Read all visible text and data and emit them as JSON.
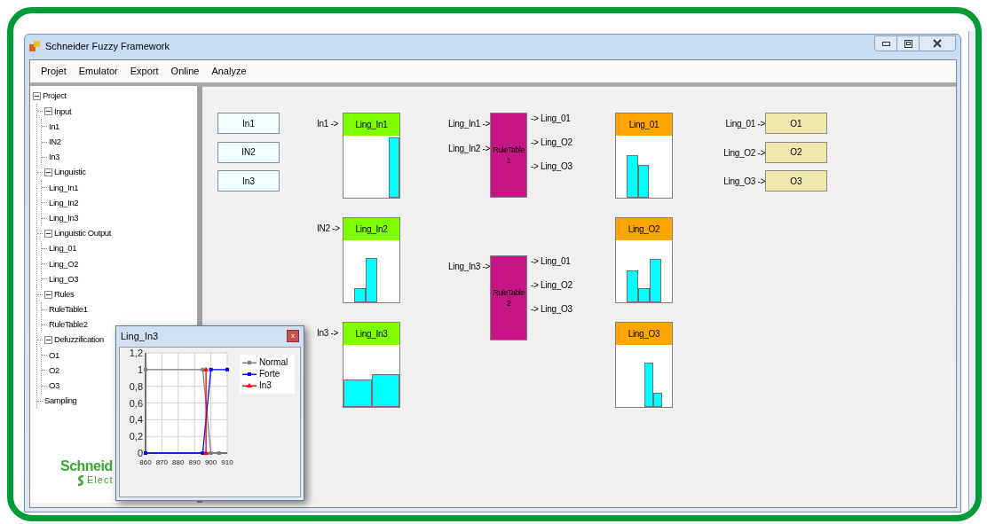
{
  "window": {
    "title": "Schneider Fuzzy Framework"
  },
  "menu": [
    "Projet",
    "Emulator",
    "Export",
    "Online",
    "Analyze"
  ],
  "tree": [
    {
      "label": "Project",
      "expanded": true,
      "children": [
        {
          "label": "Input",
          "expanded": true,
          "children": [
            {
              "label": "In1"
            },
            {
              "label": "IN2"
            },
            {
              "label": "In3"
            }
          ]
        },
        {
          "label": "Linguistic",
          "expanded": true,
          "children": [
            {
              "label": "Ling_In1"
            },
            {
              "label": "Ling_In2"
            },
            {
              "label": "Ling_In3"
            }
          ]
        },
        {
          "label": "Linguistic Output",
          "expanded": true,
          "children": [
            {
              "label": "Ling_01"
            },
            {
              "label": "Ling_O2"
            },
            {
              "label": "Ling_O3"
            }
          ]
        },
        {
          "label": "Rules",
          "expanded": true,
          "children": [
            {
              "label": "RuleTable1"
            },
            {
              "label": "RuleTable2"
            }
          ]
        },
        {
          "label": "Defuzzification",
          "expanded": true,
          "children": [
            {
              "label": "O1"
            },
            {
              "label": "O2"
            },
            {
              "label": "O3"
            }
          ]
        },
        {
          "label": "Sampling"
        }
      ]
    }
  ],
  "logo": {
    "name": "Schneid",
    "sub": "Elect"
  },
  "inputs": [
    "In1",
    "IN2",
    "In3"
  ],
  "linguistic": [
    {
      "input": "In1 ->",
      "title": "Ling_In1"
    },
    {
      "input": "IN2 ->",
      "title": "Ling_In2"
    },
    {
      "input": "In3 ->",
      "title": "Ling_In3"
    }
  ],
  "rule_tables": [
    {
      "inputs": [
        "Ling_In1 ->",
        "Ling_In2 ->"
      ],
      "label": "RuleTable\n1",
      "outputs": [
        "-> Ling_01",
        "-> Ling_O2",
        "-> Ling_O3"
      ]
    },
    {
      "inputs": [
        "Ling_In3 ->"
      ],
      "label": "RuleTable\n2",
      "outputs": [
        "-> Ling_01",
        "-> Ling_O2",
        "-> Ling_O3"
      ]
    }
  ],
  "linguistic_outputs": [
    {
      "title": "Ling_01"
    },
    {
      "title": "Ling_O2"
    },
    {
      "title": "Ling_O3"
    }
  ],
  "outputs": [
    {
      "input": "Ling_01 ->",
      "label": "O1"
    },
    {
      "input": "Ling_O2 ->",
      "label": "O2"
    },
    {
      "input": "Ling_O3 ->",
      "label": "O3"
    }
  ],
  "popup": {
    "title": "Ling_In3",
    "close": "x",
    "chart_data": {
      "type": "line",
      "grid": true,
      "legend": true,
      "xlim": [
        860,
        910
      ],
      "ylim": [
        0,
        1.2
      ],
      "xticks": [
        860,
        870,
        880,
        890,
        900,
        910
      ],
      "yticks": [
        {
          "value": 0,
          "label": "0"
        },
        {
          "value": 0.2,
          "label": "0,2"
        },
        {
          "value": 0.4,
          "label": "0,4"
        },
        {
          "value": 0.6,
          "label": "0,6"
        },
        {
          "value": 0.8,
          "label": "0,8"
        },
        {
          "value": 1,
          "label": "1"
        },
        {
          "value": 1.2,
          "label": "1,2"
        }
      ],
      "series": [
        {
          "name": "Normal",
          "color": "#808080",
          "marker": "square",
          "x": [
            860,
            895,
            900,
            905
          ],
          "values": [
            1,
            1,
            0,
            0
          ]
        },
        {
          "name": "Forte",
          "color": "#0000ff",
          "marker": "square",
          "x": [
            860,
            895,
            900,
            910
          ],
          "values": [
            0,
            0,
            1,
            1
          ]
        },
        {
          "name": "In3",
          "color": "#ff0000",
          "marker": "triangle",
          "x": [
            897,
            897
          ],
          "values": [
            0,
            1
          ]
        }
      ]
    }
  }
}
